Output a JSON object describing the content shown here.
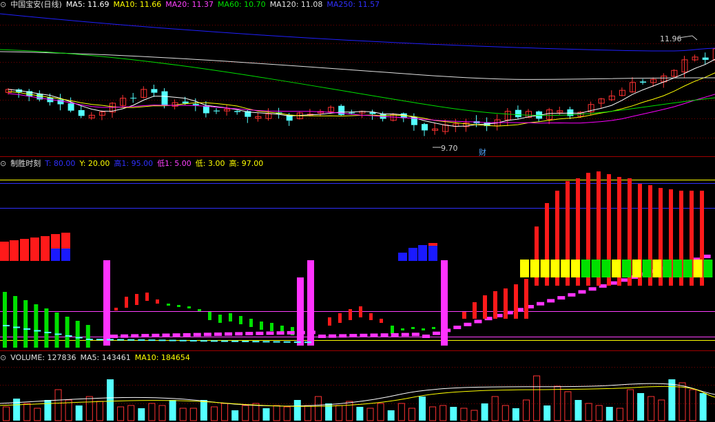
{
  "colors": {
    "up": "#ff3232",
    "down": "#54ffff",
    "ma5": "#ffffff",
    "ma10": "#ffff00",
    "ma20": "#ff00ff",
    "ma60": "#00e000",
    "ma120": "#e0e0e0",
    "ma250": "#2020ff",
    "grid": "#7a0000",
    "bg": "#000000"
  },
  "price_panel": {
    "control_icon": "circle-arrow-icon",
    "title": "中国宝安(日线)",
    "indicators": [
      {
        "label": "MA5: 11.69",
        "color": "#ffffff"
      },
      {
        "label": "MA10: 11.66",
        "color": "#ffff00"
      },
      {
        "label": "MA20: 11.37",
        "color": "#ff40ff"
      },
      {
        "label": "MA60: 10.70",
        "color": "#00e000"
      },
      {
        "label": "MA120: 11.08",
        "color": "#e0e0e0"
      },
      {
        "label": "MA250: 11.57",
        "color": "#3030ff"
      }
    ],
    "high_label": "11.96",
    "low_label": "9.70",
    "event_badge": "财"
  },
  "indicator_panel": {
    "control_icon": "circle-arrow-icon",
    "title": "制胜时刻",
    "params": [
      {
        "label": "T: 80.00",
        "color": "#3030ff"
      },
      {
        "label": "Y: 20.00",
        "color": "#ffff00"
      },
      {
        "label": "高1: 95.00",
        "color": "#3030ff"
      },
      {
        "label": "低1: 5.00",
        "color": "#ff40ff"
      },
      {
        "label": "低: 3.00",
        "color": "#ffff00"
      },
      {
        "label": "高: 97.00",
        "color": "#ffff00"
      }
    ]
  },
  "volume_panel": {
    "control_icon": "circle-arrow-icon",
    "indicators": [
      {
        "label": "VOLUME: 127836",
        "color": "#e0e0e0"
      },
      {
        "label": "MA5: 143461",
        "color": "#e0e0e0"
      },
      {
        "label": "MA10: 184654",
        "color": "#ffff00"
      }
    ]
  },
  "chart_data": [
    {
      "type": "candlestick",
      "series": [
        {
          "name": "MA5",
          "values": [
            11.69
          ]
        },
        {
          "name": "MA10",
          "values": [
            11.66
          ]
        },
        {
          "name": "MA20",
          "values": [
            11.37
          ]
        },
        {
          "name": "MA60",
          "values": [
            10.7
          ]
        },
        {
          "name": "MA120",
          "values": [
            11.08
          ]
        },
        {
          "name": "MA250",
          "values": [
            11.57
          ]
        }
      ],
      "annotations": [
        "11.96",
        "9.70",
        "财"
      ]
    },
    {
      "type": "bar",
      "title": "制胜时刻",
      "reference_lines": {
        "T": 80.0,
        "Y": 20.0,
        "高1": 95.0,
        "低1": 5.0,
        "低": 3.0,
        "高": 97.0
      }
    },
    {
      "type": "bar",
      "series": [
        {
          "name": "VOLUME",
          "values": [
            127836
          ]
        },
        {
          "name": "MA5",
          "values": [
            143461
          ]
        },
        {
          "name": "MA10",
          "values": [
            184654
          ]
        }
      ]
    }
  ]
}
